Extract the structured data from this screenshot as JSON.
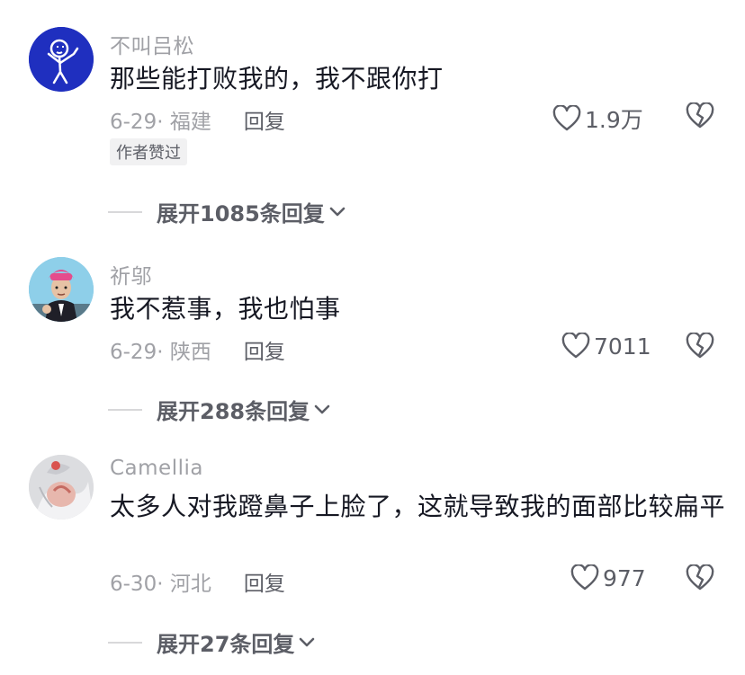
{
  "comments": [
    {
      "username": "不叫吕松",
      "content": "那些能打败我的，我不跟你打",
      "date_location": "6-29· 福建",
      "reply_label": "回复",
      "likes": "1.9万",
      "tag": "作者赞过",
      "expand_label": "展开1085条回复",
      "avatar_colors": [
        "#1f2fbf",
        "#ffffff"
      ]
    },
    {
      "username": "祈邬",
      "content": "我不惹事，我也怕事",
      "date_location": "6-29· 陕西",
      "reply_label": "回复",
      "likes": "7011",
      "expand_label": "展开288条回复",
      "avatar_colors": [
        "#7fc4e6",
        "#e54c8c"
      ]
    },
    {
      "username": "Camellia",
      "content": "太多人对我蹬鼻子上脸了，这就导致我的面部比较扁平",
      "date_location": "6-30· 河北",
      "reply_label": "回复",
      "likes": "977",
      "expand_label": "展开27条回复",
      "avatar_colors": [
        "#e6e6e8",
        "#d98880"
      ]
    }
  ],
  "icons": {
    "like": "heart-outline-icon",
    "dislike": "broken-heart-icon",
    "expand": "chevron-down-icon"
  }
}
